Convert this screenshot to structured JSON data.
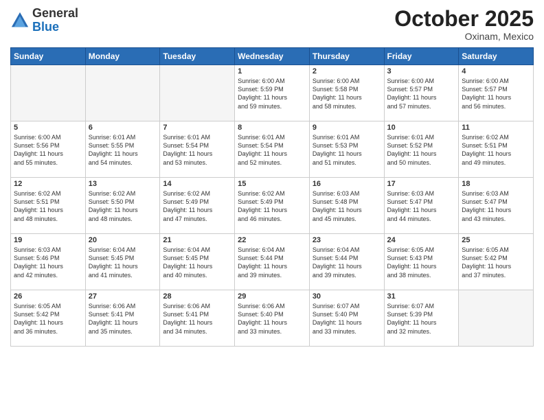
{
  "header": {
    "logo_line1": "General",
    "logo_line2": "Blue",
    "month": "October 2025",
    "location": "Oxinam, Mexico"
  },
  "weekdays": [
    "Sunday",
    "Monday",
    "Tuesday",
    "Wednesday",
    "Thursday",
    "Friday",
    "Saturday"
  ],
  "weeks": [
    [
      {
        "day": "",
        "text": ""
      },
      {
        "day": "",
        "text": ""
      },
      {
        "day": "",
        "text": ""
      },
      {
        "day": "1",
        "text": "Sunrise: 6:00 AM\nSunset: 5:59 PM\nDaylight: 11 hours\nand 59 minutes."
      },
      {
        "day": "2",
        "text": "Sunrise: 6:00 AM\nSunset: 5:58 PM\nDaylight: 11 hours\nand 58 minutes."
      },
      {
        "day": "3",
        "text": "Sunrise: 6:00 AM\nSunset: 5:57 PM\nDaylight: 11 hours\nand 57 minutes."
      },
      {
        "day": "4",
        "text": "Sunrise: 6:00 AM\nSunset: 5:57 PM\nDaylight: 11 hours\nand 56 minutes."
      }
    ],
    [
      {
        "day": "5",
        "text": "Sunrise: 6:00 AM\nSunset: 5:56 PM\nDaylight: 11 hours\nand 55 minutes."
      },
      {
        "day": "6",
        "text": "Sunrise: 6:01 AM\nSunset: 5:55 PM\nDaylight: 11 hours\nand 54 minutes."
      },
      {
        "day": "7",
        "text": "Sunrise: 6:01 AM\nSunset: 5:54 PM\nDaylight: 11 hours\nand 53 minutes."
      },
      {
        "day": "8",
        "text": "Sunrise: 6:01 AM\nSunset: 5:54 PM\nDaylight: 11 hours\nand 52 minutes."
      },
      {
        "day": "9",
        "text": "Sunrise: 6:01 AM\nSunset: 5:53 PM\nDaylight: 11 hours\nand 51 minutes."
      },
      {
        "day": "10",
        "text": "Sunrise: 6:01 AM\nSunset: 5:52 PM\nDaylight: 11 hours\nand 50 minutes."
      },
      {
        "day": "11",
        "text": "Sunrise: 6:02 AM\nSunset: 5:51 PM\nDaylight: 11 hours\nand 49 minutes."
      }
    ],
    [
      {
        "day": "12",
        "text": "Sunrise: 6:02 AM\nSunset: 5:51 PM\nDaylight: 11 hours\nand 48 minutes."
      },
      {
        "day": "13",
        "text": "Sunrise: 6:02 AM\nSunset: 5:50 PM\nDaylight: 11 hours\nand 48 minutes."
      },
      {
        "day": "14",
        "text": "Sunrise: 6:02 AM\nSunset: 5:49 PM\nDaylight: 11 hours\nand 47 minutes."
      },
      {
        "day": "15",
        "text": "Sunrise: 6:02 AM\nSunset: 5:49 PM\nDaylight: 11 hours\nand 46 minutes."
      },
      {
        "day": "16",
        "text": "Sunrise: 6:03 AM\nSunset: 5:48 PM\nDaylight: 11 hours\nand 45 minutes."
      },
      {
        "day": "17",
        "text": "Sunrise: 6:03 AM\nSunset: 5:47 PM\nDaylight: 11 hours\nand 44 minutes."
      },
      {
        "day": "18",
        "text": "Sunrise: 6:03 AM\nSunset: 5:47 PM\nDaylight: 11 hours\nand 43 minutes."
      }
    ],
    [
      {
        "day": "19",
        "text": "Sunrise: 6:03 AM\nSunset: 5:46 PM\nDaylight: 11 hours\nand 42 minutes."
      },
      {
        "day": "20",
        "text": "Sunrise: 6:04 AM\nSunset: 5:45 PM\nDaylight: 11 hours\nand 41 minutes."
      },
      {
        "day": "21",
        "text": "Sunrise: 6:04 AM\nSunset: 5:45 PM\nDaylight: 11 hours\nand 40 minutes."
      },
      {
        "day": "22",
        "text": "Sunrise: 6:04 AM\nSunset: 5:44 PM\nDaylight: 11 hours\nand 39 minutes."
      },
      {
        "day": "23",
        "text": "Sunrise: 6:04 AM\nSunset: 5:44 PM\nDaylight: 11 hours\nand 39 minutes."
      },
      {
        "day": "24",
        "text": "Sunrise: 6:05 AM\nSunset: 5:43 PM\nDaylight: 11 hours\nand 38 minutes."
      },
      {
        "day": "25",
        "text": "Sunrise: 6:05 AM\nSunset: 5:42 PM\nDaylight: 11 hours\nand 37 minutes."
      }
    ],
    [
      {
        "day": "26",
        "text": "Sunrise: 6:05 AM\nSunset: 5:42 PM\nDaylight: 11 hours\nand 36 minutes."
      },
      {
        "day": "27",
        "text": "Sunrise: 6:06 AM\nSunset: 5:41 PM\nDaylight: 11 hours\nand 35 minutes."
      },
      {
        "day": "28",
        "text": "Sunrise: 6:06 AM\nSunset: 5:41 PM\nDaylight: 11 hours\nand 34 minutes."
      },
      {
        "day": "29",
        "text": "Sunrise: 6:06 AM\nSunset: 5:40 PM\nDaylight: 11 hours\nand 33 minutes."
      },
      {
        "day": "30",
        "text": "Sunrise: 6:07 AM\nSunset: 5:40 PM\nDaylight: 11 hours\nand 33 minutes."
      },
      {
        "day": "31",
        "text": "Sunrise: 6:07 AM\nSunset: 5:39 PM\nDaylight: 11 hours\nand 32 minutes."
      },
      {
        "day": "",
        "text": ""
      }
    ]
  ]
}
